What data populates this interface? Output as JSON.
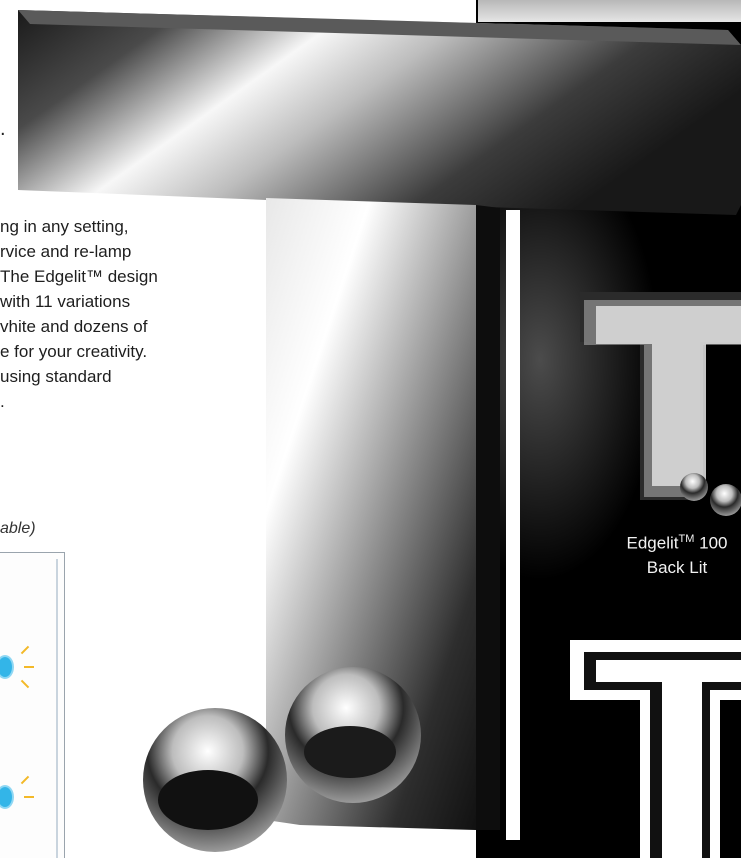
{
  "intro": {
    "period_mark": "."
  },
  "body_text": {
    "lines": [
      "ng in any setting,",
      "rvice and re-lamp",
      "The Edgelit™ design",
      " with 11 variations",
      "vhite and dozens of",
      "e for your creativity.",
      "using standard",
      "."
    ]
  },
  "note": "able)",
  "caption": {
    "brand": "Edgelit",
    "trademark": "TM",
    "model": "100",
    "type": "Back Lit"
  },
  "colors": {
    "panel_black": "#000000",
    "led_blue": "#33b5e8",
    "led_ray": "#f3b928"
  }
}
